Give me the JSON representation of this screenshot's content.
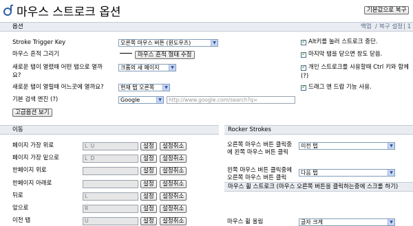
{
  "app": {
    "title": "마우스 스트로크 옵션",
    "reset_button": "기본값으로 복구"
  },
  "options_bar": {
    "heading": "옵션",
    "backup_link": "백업",
    "restore_link": "복구 설정",
    "trail": "| 1"
  },
  "settings": {
    "stroke_key": {
      "label": "Stroke Trigger Key",
      "value": "오른쪽 마우스 버튼 (윈도우즈)"
    },
    "trail": {
      "label": "마우스 흔적 그리기",
      "button": "마우스 흔적 형태 수정"
    },
    "new_tab_open": {
      "label": "새로운 탭이 열렸때 어떤 탭으로 열까요?",
      "value": "크롬의 새 페이지"
    },
    "new_tab_where": {
      "label": "새로운 탭이 열릴때 어느곳에 열까요?",
      "value": "현재 탭 오른쪽"
    },
    "search": {
      "label": "기본 검색 엔진 (?)",
      "engine": "Google",
      "url": "http://www.google.com/search?q="
    },
    "advanced_button": "고급옵션 보기"
  },
  "checkboxes": [
    {
      "label": "Alt키를 눌러 스트로크 중단.",
      "checked": true
    },
    {
      "label": "마지막 탭을 닫으면 창도 닫음.",
      "checked": true
    },
    {
      "label": "개인 스트로크를 사용할때 Ctrl 키와 함께",
      "checked": true
    },
    {
      "label": "(?)",
      "checked": false
    },
    {
      "label": "드래그 앤 드랍 기능 사용.",
      "checked": true
    }
  ],
  "move_section": {
    "heading": "이동",
    "set_label": "설정",
    "cancel_label": "설정취소",
    "rows": [
      {
        "label": "페이지 가장 위로",
        "value": "L U"
      },
      {
        "label": "페이지 가장 밑으로",
        "value": "L D"
      },
      {
        "label": "한페이지 위로",
        "value": ""
      },
      {
        "label": "한페이지 아래로",
        "value": ""
      },
      {
        "label": "뒤로",
        "value": "L"
      },
      {
        "label": "앞으로",
        "value": "R"
      },
      {
        "label": "이전 탭",
        "value": "U"
      }
    ]
  },
  "rocker_section": {
    "heading": "Rocker Strokes",
    "rows": [
      {
        "label": "오른쪽 마우스 버튼 클릭중에 왼쪽 마우스 버튼 클릭",
        "value": "이전 탭"
      },
      {
        "label": "왼쪽 마우스 버튼 클릭중에 오른쪽 마우스 버튼 클릭",
        "value": "다음 탭"
      }
    ]
  },
  "wheel_section": {
    "heading": "마우스 휠 스트로크 (마우스 오른쪽 버튼을 클릭하는중에 스크롤 하기)",
    "row": {
      "label": "마우스 휠 올림",
      "value": "글자 크게"
    }
  }
}
